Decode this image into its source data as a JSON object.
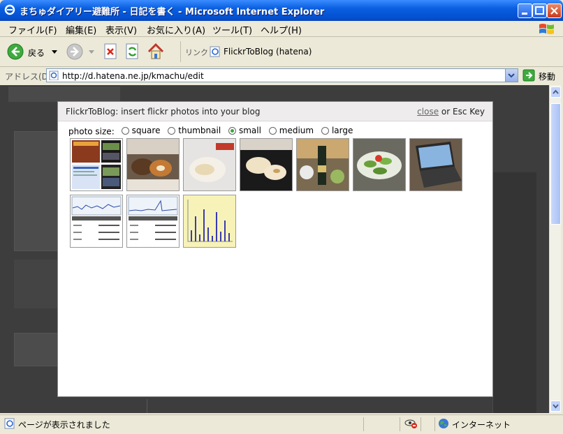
{
  "window": {
    "title": "まちゅダイアリー避難所 - 日記を書く - Microsoft Internet Explorer"
  },
  "menu": {
    "items": [
      "ファイル(F)",
      "編集(E)",
      "表示(V)",
      "お気に入り(A)",
      "ツール(T)",
      "ヘルプ(H)"
    ]
  },
  "toolbar": {
    "back_label": "戻る",
    "links_label": "リンク",
    "link_item": "FlickrToBlog (hatena)"
  },
  "address": {
    "label": "アドレス(D)",
    "url": "http://d.hatena.ne.jp/kmachu/edit",
    "go_label": "移動"
  },
  "modal": {
    "title": "FlickrToBlog: insert flickr photos into your blog",
    "close_link": "close",
    "close_suffix": " or Esc Key",
    "photo_size_label": "photo size:",
    "sizes": [
      "square",
      "thumbnail",
      "small",
      "medium",
      "large"
    ],
    "selected_size": "small"
  },
  "status": {
    "text": "ページが表示されました",
    "zone": "インターネット"
  },
  "colors": {
    "title_blue": "#0A5FE0",
    "overlay": "#3d3d3d",
    "radio_selected": "#3BA63B"
  }
}
